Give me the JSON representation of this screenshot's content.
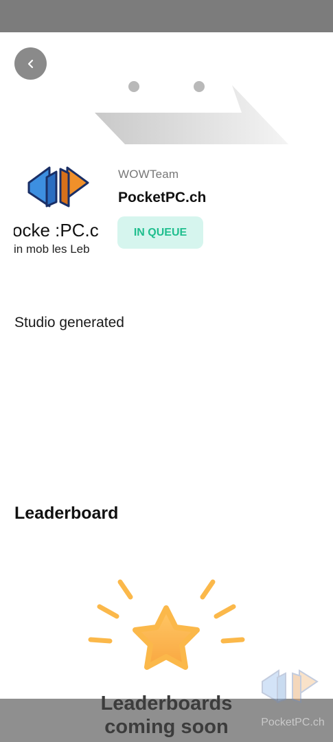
{
  "team": {
    "owner": "WOWTeam",
    "name": "PocketPC.ch",
    "status": "IN QUEUE",
    "logo_text_line1": "ocke :PC.c",
    "logo_text_line2": "in mob les Leb"
  },
  "studio_text": "Studio generated",
  "leaderboard": {
    "title": "Leaderboard",
    "empty_message_line1": "Leaderboards",
    "empty_message_line2": "coming soon"
  },
  "watermark": "PocketPC.ch",
  "colors": {
    "badge_bg": "#d6f5ee",
    "badge_text": "#1fbe8e",
    "star": "#fbb84a",
    "logo_blue": "#3d8fe0",
    "logo_orange": "#f0902a"
  },
  "icons": {
    "back": "chevron-left-icon",
    "star": "star-icon"
  }
}
